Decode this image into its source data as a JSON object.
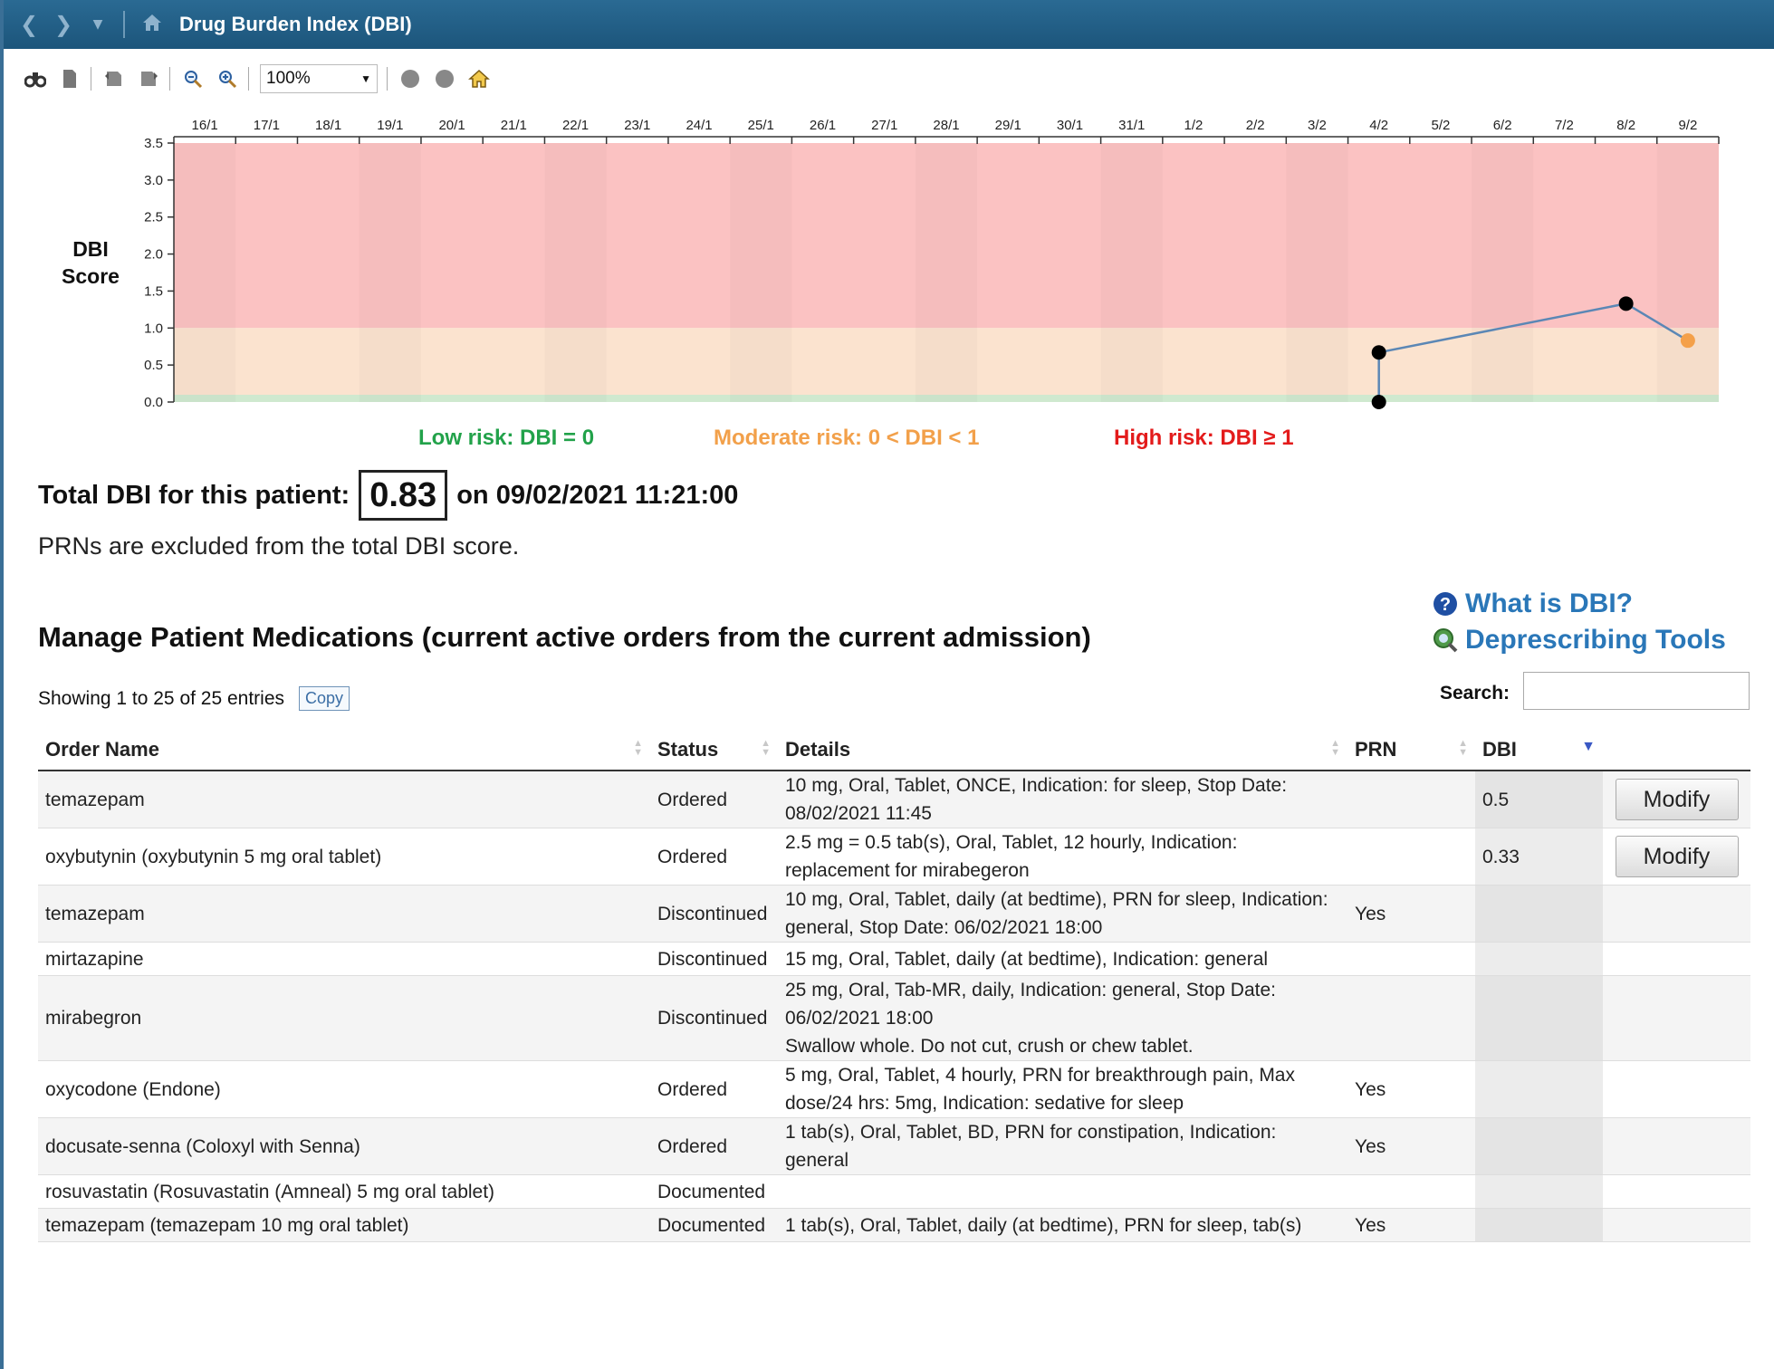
{
  "window": {
    "title": "Drug Burden Index (DBI)"
  },
  "toolbar": {
    "icons": [
      "find-icon",
      "page-icon",
      "print-icon",
      "print-preview-icon",
      "zoom-out-icon",
      "zoom-in-icon",
      "circle-icon",
      "circle-icon",
      "home-icon"
    ],
    "zoom_value": "100%"
  },
  "chart_data": {
    "type": "line",
    "ylabel": "DBI Score",
    "yticks": [
      "0.0",
      "0.5",
      "1.0",
      "1.5",
      "2.0",
      "2.5",
      "3.0",
      "3.5"
    ],
    "ylim": [
      0,
      3.5
    ],
    "x_categories": [
      "16/1",
      "17/1",
      "18/1",
      "19/1",
      "20/1",
      "21/1",
      "22/1",
      "23/1",
      "24/1",
      "25/1",
      "26/1",
      "27/1",
      "28/1",
      "29/1",
      "30/1",
      "31/1",
      "1/2",
      "2/2",
      "3/2",
      "4/2",
      "5/2",
      "6/2",
      "7/2",
      "8/2",
      "9/2"
    ],
    "x_axis_position": "top",
    "bands": [
      {
        "name": "Low risk",
        "range": [
          0,
          0.05
        ],
        "color": "#cfe9cf"
      },
      {
        "name": "Moderate risk",
        "range": [
          0,
          1
        ],
        "color": "#fbe3cf"
      },
      {
        "name": "High risk",
        "range": [
          1,
          3.5
        ],
        "color": "#fbc2c2"
      }
    ],
    "series": [
      {
        "points": [
          {
            "x": "4/2",
            "y": 0,
            "color": "#000000"
          },
          {
            "x": "4/2",
            "y": 0.67,
            "color": "#000000"
          },
          {
            "x": "8/2",
            "y": 1.33,
            "color": "#000000"
          },
          {
            "x": "9/2",
            "y": 0.83,
            "color": "#f4a04a"
          }
        ],
        "line_color": "#5b87b5"
      }
    ]
  },
  "legend": {
    "low": "Low risk: DBI = 0",
    "moderate": "Moderate risk: 0 < DBI < 1",
    "high": "High risk: DBI ≥ 1",
    "low_color": "#22a24a",
    "moderate_color": "#f2a04a",
    "high_color": "#e31b1b"
  },
  "summary": {
    "label": "Total DBI for this patient:",
    "score": "0.83",
    "date_text": "on 09/02/2021 11:21:00",
    "note": "PRNs are excluded from the total DBI score."
  },
  "links": {
    "what_is_dbi": "What is DBI?",
    "deprescribing": "Deprescribing Tools"
  },
  "section": {
    "title": "Manage Patient Medications (current active orders from the current admission)",
    "showing": "Showing 1 to 25 of 25 entries",
    "copy_label": "Copy",
    "search_label": "Search:",
    "search_value": ""
  },
  "table": {
    "columns": [
      "Order Name",
      "Status",
      "Details",
      "PRN",
      "DBI"
    ],
    "modify_label": "Modify",
    "rows": [
      {
        "name": "temazepam",
        "status": "Ordered",
        "details": [
          "10 mg, Oral, Tablet, ONCE, Indication: for sleep, Stop Date:",
          "08/02/2021 11:45"
        ],
        "prn": "",
        "dbi": "0.5",
        "modify": true
      },
      {
        "name": "oxybutynin (oxybutynin 5 mg oral tablet)",
        "status": "Ordered",
        "details": [
          "2.5 mg = 0.5 tab(s), Oral, Tablet, 12 hourly, Indication:",
          "replacement for mirabegeron"
        ],
        "prn": "",
        "dbi": "0.33",
        "modify": true
      },
      {
        "name": "temazepam",
        "status": "Discontinued",
        "details": [
          "10 mg, Oral, Tablet, daily (at bedtime), PRN for sleep, Indication:",
          "general, Stop Date: 06/02/2021 18:00"
        ],
        "prn": "Yes",
        "dbi": "",
        "modify": false
      },
      {
        "name": "mirtazapine",
        "status": "Discontinued",
        "details": [
          "15 mg, Oral, Tablet, daily (at bedtime), Indication: general"
        ],
        "prn": "",
        "dbi": "",
        "modify": false
      },
      {
        "name": "mirabegron",
        "status": "Discontinued",
        "details": [
          "25 mg, Oral, Tab-MR, daily, Indication: general, Stop Date:",
          "06/02/2021 18:00",
          "Swallow whole. Do not cut, crush or chew tablet."
        ],
        "prn": "",
        "dbi": "",
        "modify": false
      },
      {
        "name": "oxycodone (Endone)",
        "status": "Ordered",
        "details": [
          "5 mg, Oral, Tablet, 4 hourly, PRN for breakthrough pain, Max",
          "dose/24 hrs: 5mg, Indication: sedative for sleep"
        ],
        "prn": "Yes",
        "dbi": "",
        "modify": false
      },
      {
        "name": "docusate-senna (Coloxyl with Senna)",
        "status": "Ordered",
        "details": [
          "1 tab(s), Oral, Tablet, BD, PRN for constipation, Indication:",
          "general"
        ],
        "prn": "Yes",
        "dbi": "",
        "modify": false
      },
      {
        "name": "rosuvastatin (Rosuvastatin (Amneal) 5 mg oral tablet)",
        "status": "Documented",
        "details": [],
        "prn": "",
        "dbi": "",
        "modify": false
      },
      {
        "name": "temazepam (temazepam 10 mg oral tablet)",
        "status": "Documented",
        "details": [
          "1 tab(s), Oral, Tablet, daily (at bedtime), PRN for sleep, tab(s)"
        ],
        "prn": "Yes",
        "dbi": "",
        "modify": false
      }
    ]
  }
}
